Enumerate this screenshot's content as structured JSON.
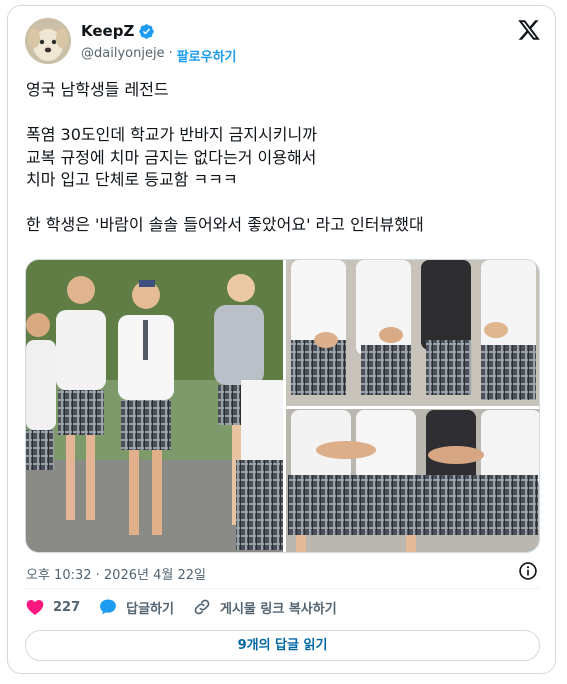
{
  "author": {
    "display_name": "KeepZ",
    "handle": "@dailyonjeje",
    "follow_label": "팔로우하기",
    "verified": true,
    "avatar_icon": "dog-avatar"
  },
  "post": {
    "text": "영국 남학생들 레전드\n\n폭염 30도인데 학교가 반바지 금지시키니까\n교복 규정에 치마 금지는 없다는거 이용해서\n치마 입고 단체로 등교함 ㅋㅋㅋ\n\n한 학생은 '바람이 솔솔 들어와서 좋았어요' 라고 인터뷰했대",
    "timestamp": "오후 10:32 · 2026년 4월 22일"
  },
  "media": {
    "images": [
      {
        "icon": "students-in-skirts-photo"
      },
      {
        "icon": "students-in-skirts-photo"
      },
      {
        "icon": "students-in-skirts-photo"
      }
    ]
  },
  "actions": {
    "like_count": "227",
    "reply_label": "답글하기",
    "copy_link_label": "게시물 링크 복사하기"
  },
  "replies_button_label": "9개의 답글 읽기",
  "colors": {
    "accent": "#1d9bf0",
    "like": "#f91880",
    "text": "#0f1419",
    "muted": "#536471",
    "border": "#cfd9de"
  }
}
